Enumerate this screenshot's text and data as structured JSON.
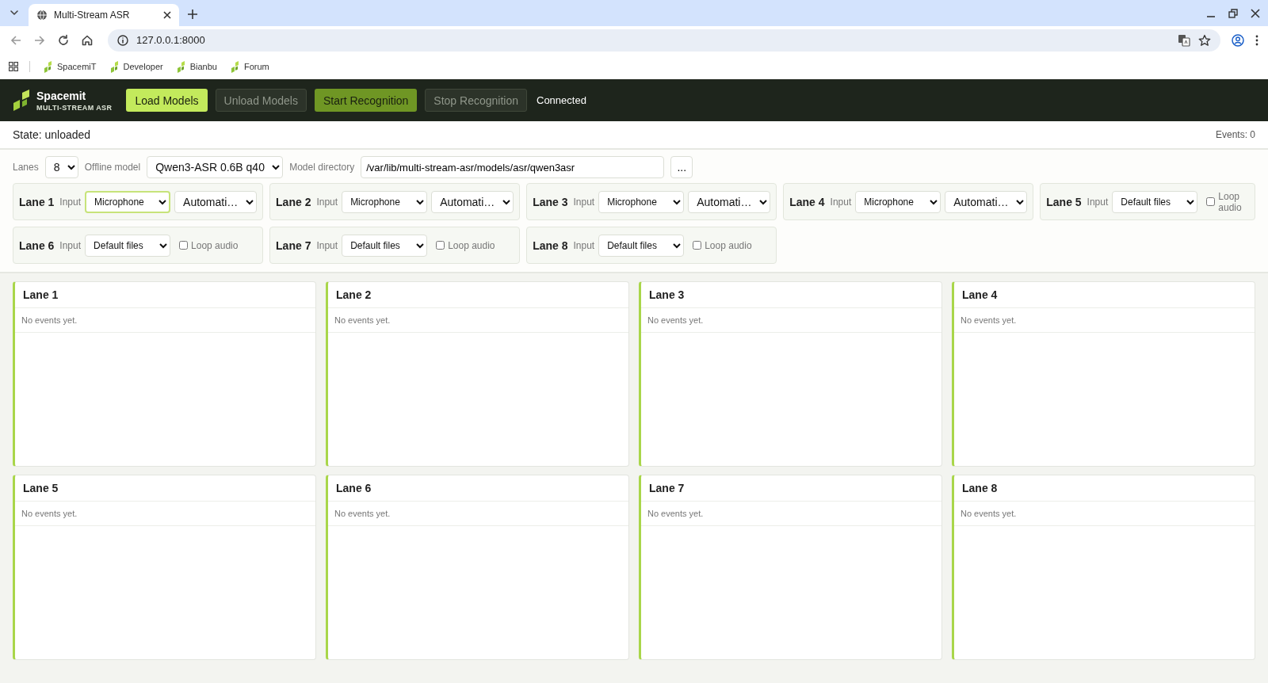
{
  "browser": {
    "tab_title": "Multi-Stream ASR",
    "url": "127.0.0.1:8000",
    "bookmarks": [
      "SpacemiT",
      "Developer",
      "Bianbu",
      "Forum"
    ]
  },
  "header": {
    "brand": "Spacemit",
    "subtitle": "MULTI-STREAM ASR",
    "status": "Connected",
    "buttons": [
      {
        "label": "Load Models",
        "kind": "primary",
        "disabled": false
      },
      {
        "label": "Unload Models",
        "kind": "plain",
        "disabled": true
      },
      {
        "label": "Start Recognition",
        "kind": "accent",
        "disabled": false
      },
      {
        "label": "Stop Recognition",
        "kind": "plain",
        "disabled": true
      }
    ]
  },
  "state_bar": {
    "state": "State: unloaded",
    "events": "Events: 0"
  },
  "settings": {
    "lanes_label": "Lanes",
    "lanes": "8",
    "model_label": "Offline model",
    "model": "Qwen3-ASR 0.6B q40",
    "directory_label": "Model directory",
    "directory": "/var/lib/multi-stream-asr/models/asr/qwen3asr",
    "browse": "..."
  },
  "lane_configs": [
    {
      "name": "Lane 1",
      "input_label": "Input",
      "kind": "microphone",
      "input": "Microphone",
      "focused": true,
      "mode": "Automati…"
    },
    {
      "name": "Lane 2",
      "input_label": "Input",
      "kind": "microphone",
      "input": "Microphone",
      "focused": false,
      "mode": "Automati…"
    },
    {
      "name": "Lane 3",
      "input_label": "Input",
      "kind": "microphone",
      "input": "Microphone",
      "focused": false,
      "mode": "Automati…"
    },
    {
      "name": "Lane 4",
      "input_label": "Input",
      "kind": "microphone",
      "input": "Microphone",
      "focused": false,
      "mode": "Automati…"
    },
    {
      "name": "Lane 5",
      "input_label": "Input",
      "kind": "files",
      "input": "Default files",
      "focused": false,
      "loop_label": "Loop audio",
      "checked": false
    },
    {
      "name": "Lane 6",
      "input_label": "Input",
      "kind": "files",
      "input": "Default files",
      "focused": false,
      "loop_label": "Loop audio",
      "checked": false
    },
    {
      "name": "Lane 7",
      "input_label": "Input",
      "kind": "files",
      "input": "Default files",
      "focused": false,
      "loop_label": "Loop audio",
      "checked": false
    },
    {
      "name": "Lane 8",
      "input_label": "Input",
      "kind": "files",
      "input": "Default files",
      "focused": false,
      "loop_label": "Loop audio",
      "checked": false
    }
  ],
  "lanes": [
    {
      "title": "Lane 1",
      "message": "No events yet."
    },
    {
      "title": "Lane 2",
      "message": "No events yet."
    },
    {
      "title": "Lane 3",
      "message": "No events yet."
    },
    {
      "title": "Lane 4",
      "message": "No events yet."
    },
    {
      "title": "Lane 5",
      "message": "No events yet."
    },
    {
      "title": "Lane 6",
      "message": "No events yet."
    },
    {
      "title": "Lane 7",
      "message": "No events yet."
    },
    {
      "title": "Lane 8",
      "message": "No events yet."
    }
  ]
}
